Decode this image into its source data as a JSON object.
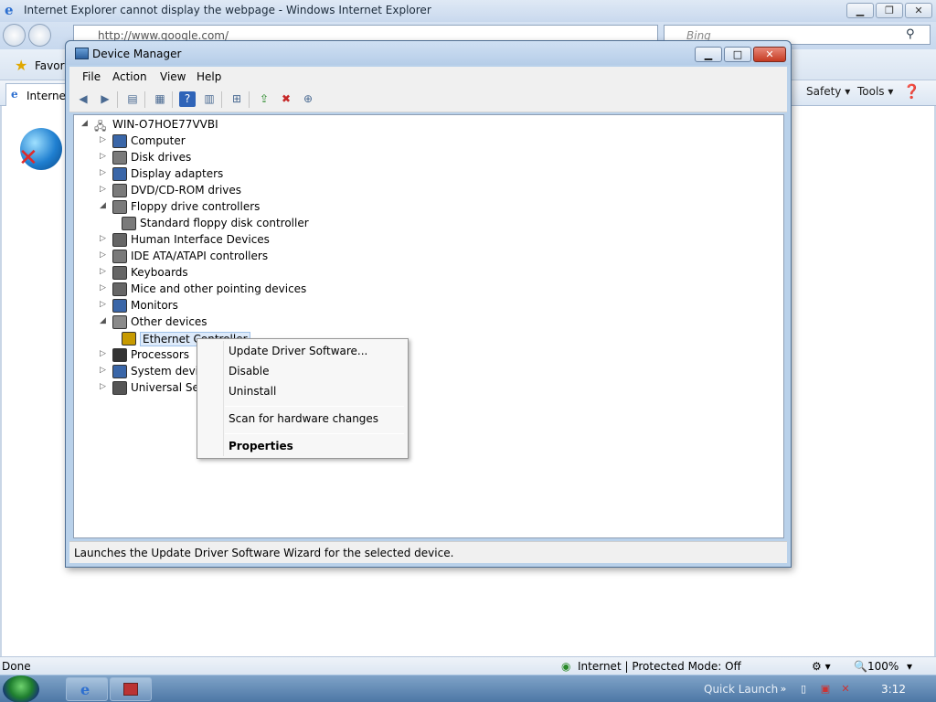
{
  "ie": {
    "title": "Internet Explorer cannot display the webpage - Windows Internet Explorer",
    "address": "http://www.google.com/",
    "search_placeholder": "Bing",
    "favorites_label": "Favori",
    "tab_label": "Internet",
    "cmd": {
      "safety": "Safety",
      "tools": "Tools"
    },
    "status": {
      "done": "Done",
      "zone": "Internet | Protected Mode: Off",
      "zoom": "100%"
    }
  },
  "dm": {
    "title": "Device Manager",
    "menu": [
      "File",
      "Action",
      "View",
      "Help"
    ],
    "root": "WIN-O7HOE77VVBI",
    "tree": [
      {
        "label": "Computer",
        "expanded": false,
        "level": 1
      },
      {
        "label": "Disk drives",
        "expanded": false,
        "level": 1
      },
      {
        "label": "Display adapters",
        "expanded": false,
        "level": 1
      },
      {
        "label": "DVD/CD-ROM drives",
        "expanded": false,
        "level": 1
      },
      {
        "label": "Floppy drive controllers",
        "expanded": true,
        "level": 1
      },
      {
        "label": "Standard floppy disk controller",
        "level": 2
      },
      {
        "label": "Human Interface Devices",
        "expanded": false,
        "level": 1
      },
      {
        "label": "IDE ATA/ATAPI controllers",
        "expanded": false,
        "level": 1
      },
      {
        "label": "Keyboards",
        "expanded": false,
        "level": 1
      },
      {
        "label": "Mice and other pointing devices",
        "expanded": false,
        "level": 1
      },
      {
        "label": "Monitors",
        "expanded": false,
        "level": 1
      },
      {
        "label": "Other devices",
        "expanded": true,
        "level": 1
      },
      {
        "label": "Ethernet Controller",
        "level": 2,
        "selected": true
      },
      {
        "label": "Processors",
        "expanded": false,
        "level": 1
      },
      {
        "label": "System device",
        "expanded": false,
        "level": 1
      },
      {
        "label": "Universal Seria",
        "expanded": false,
        "level": 1
      }
    ],
    "status": "Launches the Update Driver Software Wizard for the selected device."
  },
  "context_menu": {
    "items": [
      "Update Driver Software...",
      "Disable",
      "Uninstall",
      "Scan for hardware changes",
      "Properties"
    ]
  },
  "taskbar": {
    "quick_launch": "Quick Launch",
    "clock": "3:12"
  },
  "colors": {
    "accent": "#2d6fd0",
    "selection": "#ddeafa",
    "taskbar": "#4d77a5"
  }
}
